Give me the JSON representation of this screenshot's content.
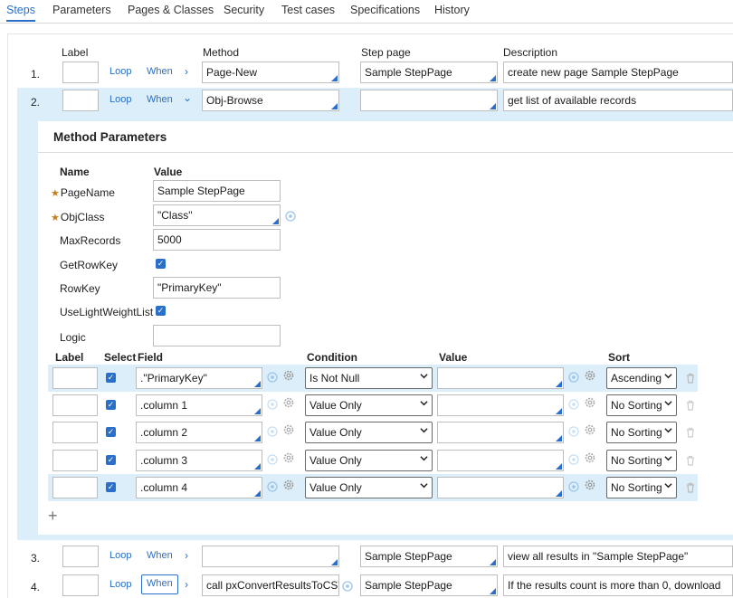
{
  "tabs": [
    "Steps",
    "Parameters",
    "Pages & Classes",
    "Security",
    "Test cases",
    "Specifications",
    "History"
  ],
  "headers": {
    "label": "Label",
    "method": "Method",
    "step_page": "Step page",
    "description": "Description"
  },
  "links": {
    "loop": "Loop",
    "when": "When"
  },
  "steps": [
    {
      "num": "1.",
      "method": "Page-New",
      "step_page": "Sample StepPage",
      "description": "create new page Sample StepPage"
    },
    {
      "num": "2.",
      "method": "Obj-Browse",
      "step_page": "",
      "description": "get list of available records"
    },
    {
      "num": "3.",
      "method": "",
      "step_page": "Sample StepPage",
      "description": "view all results in \"Sample StepPage\""
    },
    {
      "num": "4.",
      "method": "call pxConvertResultsToCSV",
      "step_page": "Sample StepPage",
      "description": "If the results count is more than 0, download"
    }
  ],
  "method_params": {
    "title": "Method Parameters",
    "name_header": "Name",
    "value_header": "Value",
    "params": [
      {
        "name": "PageName",
        "required": true,
        "value": "Sample StepPage"
      },
      {
        "name": "ObjClass",
        "required": true,
        "value": "\"Class\""
      },
      {
        "name": "MaxRecords",
        "value": "5000"
      },
      {
        "name": "GetRowKey",
        "checked": true
      },
      {
        "name": "RowKey",
        "value": "\"PrimaryKey\""
      },
      {
        "name": "UseLightWeightList",
        "checked": true
      },
      {
        "name": "Logic",
        "value": ""
      }
    ],
    "cond_headers": {
      "label": "Label",
      "select": "Select",
      "field": "Field",
      "condition": "Condition",
      "value": "Value",
      "sort": "Sort"
    },
    "conditions": [
      {
        "field": ".\"PrimaryKey\"",
        "condition": "Is Not Null",
        "value": "",
        "sort": "Ascending",
        "selected": true
      },
      {
        "field": ".column 1",
        "condition": "Value Only",
        "value": "",
        "sort": "No Sorting"
      },
      {
        "field": ".column 2",
        "condition": "Value Only",
        "value": "",
        "sort": "No Sorting"
      },
      {
        "field": ".column 3",
        "condition": "Value Only",
        "value": "",
        "sort": "No Sorting"
      },
      {
        "field": ".column 4",
        "condition": "Value Only",
        "value": "",
        "sort": "No Sorting",
        "selected": true
      }
    ],
    "add_symbol": "+"
  },
  "colors": {
    "accent": "#2a6fc9",
    "selected_bg": "#dbeef9",
    "required": "#c47c1c"
  }
}
